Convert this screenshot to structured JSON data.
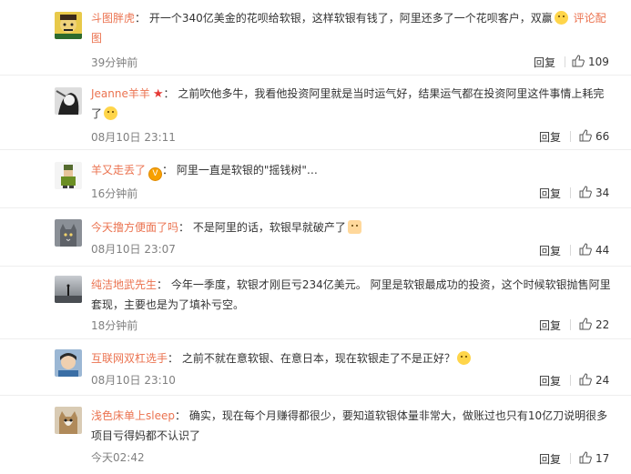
{
  "comments": [
    {
      "user": "斗图胖虎",
      "badge": "",
      "text": "开一个340亿美金的花呗给软银，这样软银有钱了，阿里还多了一个花呗客户，双赢",
      "emoji": "laugh-emoji",
      "tail": "评论配图",
      "time": "39分钟前",
      "reply": "回复",
      "likes": "109"
    },
    {
      "user": "Jeanne羊羊",
      "badge": "★",
      "text": "之前吹他多牛，我看他投资阿里就是当时运气好，结果运气都在投资阿里这件事情上耗完了",
      "emoji": "smirk-emoji",
      "tail": "",
      "time": "08月10日 23:11",
      "reply": "回复",
      "likes": "66"
    },
    {
      "user": "羊又走丢了",
      "badge": "V",
      "text": "阿里一直是软银的\"摇钱树\"…",
      "emoji": "",
      "tail": "",
      "time": "16分钟前",
      "reply": "回复",
      "likes": "34"
    },
    {
      "user": "今天撸方便面了吗",
      "badge": "",
      "text": "不是阿里的话，软银早就破产了",
      "emoji": "fox-emoji",
      "tail": "",
      "time": "08月10日 23:07",
      "reply": "回复",
      "likes": "44"
    },
    {
      "user": "纯洁地武先生",
      "badge": "",
      "text": "今年一季度，软银才刚巨亏234亿美元。 阿里是软银最成功的投资，这个时候软银抛售阿里套现，主要也是为了填补亏空。",
      "emoji": "",
      "tail": "",
      "time": "18分钟前",
      "reply": "回复",
      "likes": "22"
    },
    {
      "user": "互联网双杠选手",
      "badge": "",
      "text": "之前不就在意软银、在意日本，现在软银走了不是正好？",
      "emoji": "thinking-emoji",
      "tail": "",
      "time": "08月10日 23:10",
      "reply": "回复",
      "likes": "24"
    },
    {
      "user": "浅色床单上sleep",
      "badge": "",
      "text": "确实，现在每个月赚得都很少，要知道软银体量非常大，做账过也只有10亿刀说明很多项目亏得妈都不认识了",
      "emoji": "",
      "tail": "",
      "time": "今天02:42",
      "reply": "回复",
      "likes": "17"
    }
  ],
  "colors": {
    "username": "#eb7350",
    "text": "#333333",
    "meta": "#808080",
    "divider": "#eeeeee"
  }
}
